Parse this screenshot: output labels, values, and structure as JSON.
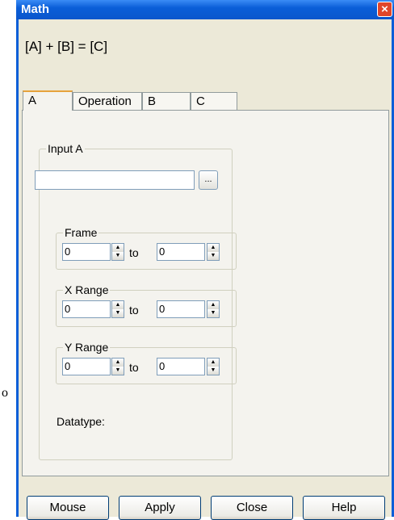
{
  "stray_text": "o",
  "window": {
    "title": "Math",
    "close_glyph": "×",
    "formula": "[A] + [B] = [C]"
  },
  "tabs": [
    {
      "label": "A",
      "active": true
    },
    {
      "label": "Operation",
      "active": false
    },
    {
      "label": "B",
      "active": false
    },
    {
      "label": "C",
      "active": false
    }
  ],
  "input_a": {
    "group_label": "Input A",
    "path_value": "",
    "browse_label": "..."
  },
  "frame": {
    "label": "Frame",
    "from": "0",
    "to_label": "to",
    "to": "0"
  },
  "x_range": {
    "label": "X Range",
    "from": "0",
    "to_label": "to",
    "to": "0"
  },
  "y_range": {
    "label": "Y Range",
    "from": "0",
    "to_label": "to",
    "to": "0"
  },
  "datatype_label": "Datatype:",
  "buttons": {
    "mouse": "Mouse",
    "apply": "Apply",
    "close": "Close",
    "help": "Help"
  },
  "colors": {
    "title_bar": "#0a5ed8",
    "client_bg": "#ece9d8",
    "tab_highlight": "#e6a23c"
  }
}
